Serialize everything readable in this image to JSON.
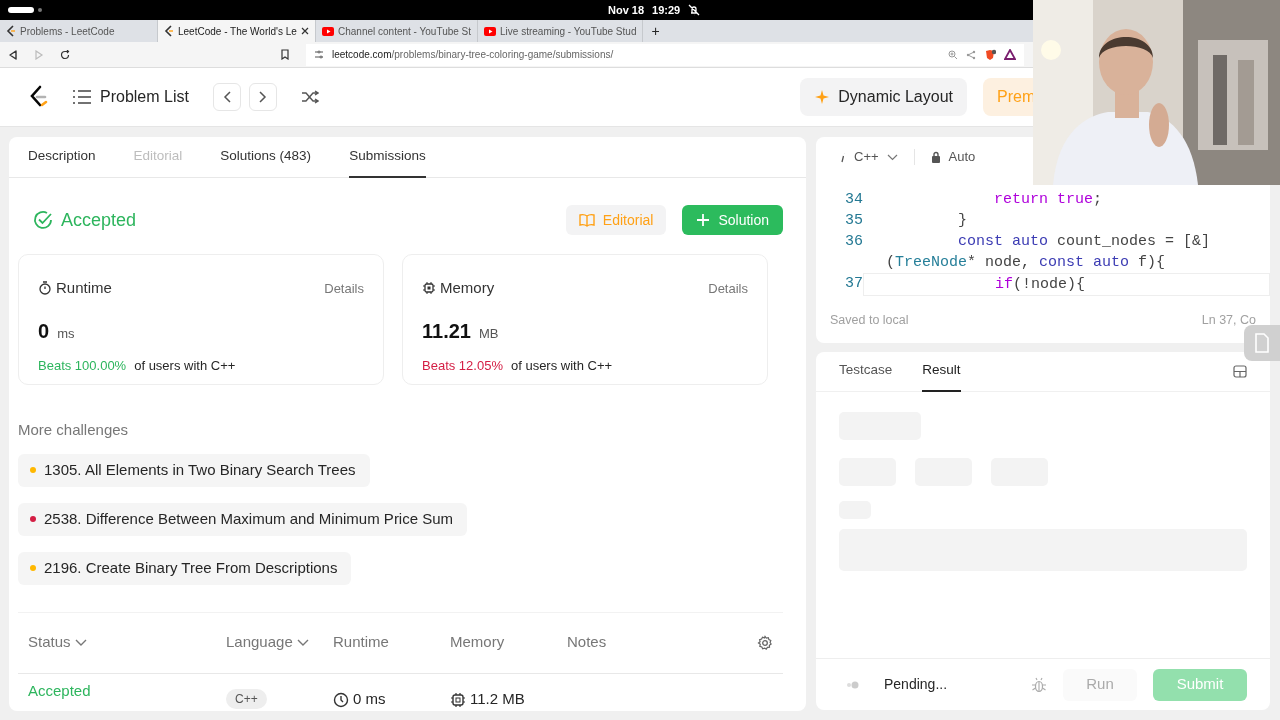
{
  "system_bar": {
    "date": "Nov 18",
    "time": "19:29"
  },
  "browser": {
    "tabs": [
      {
        "title": "Problems - LeetCode",
        "kind": "leetcode",
        "selected": false
      },
      {
        "title": "LeetCode - The World's Le",
        "kind": "leetcode",
        "selected": true
      },
      {
        "title": "Channel content - YouTube St",
        "kind": "youtube",
        "selected": false
      },
      {
        "title": "Live streaming - YouTube Stud",
        "kind": "youtube",
        "selected": false
      }
    ],
    "new_tab": "+",
    "url_host": "leetcode.com",
    "url_path": "/problems/binary-tree-coloring-game/submissions/"
  },
  "nav": {
    "problem_list": "Problem List",
    "dynamic_layout": "Dynamic Layout",
    "premium": "Prem"
  },
  "left_panel": {
    "tabs": [
      {
        "label": "Description",
        "selected": false,
        "disabled": false
      },
      {
        "label": "Editorial",
        "selected": false,
        "disabled": true
      },
      {
        "label": "Solutions (483)",
        "selected": false,
        "disabled": false
      },
      {
        "label": "Submissions",
        "selected": true,
        "disabled": false
      }
    ],
    "result": {
      "status": "Accepted",
      "editorial_button": "Editorial",
      "solution_button": "Solution"
    },
    "stats": [
      {
        "kind": "runtime",
        "title": "Runtime",
        "details": "Details",
        "value": "0",
        "unit": "ms",
        "beats": "Beats 100.00%",
        "color": "#2db55d",
        "suffix": "of users with C++"
      },
      {
        "kind": "memory",
        "title": "Memory",
        "details": "Details",
        "value": "11.21",
        "unit": "MB",
        "beats": "Beats 12.05%",
        "color": "#d41e44",
        "suffix": "of users with C++"
      }
    ],
    "more_challenges": {
      "title": "More challenges",
      "items": [
        {
          "label": "1305. All Elements in Two Binary Search Trees",
          "color": "#ffb800"
        },
        {
          "label": "2538. Difference Between Maximum and Minimum Price Sum",
          "color": "#d41e44"
        },
        {
          "label": "2196. Create Binary Tree From Descriptions",
          "color": "#ffb800"
        }
      ]
    },
    "submissions_table": {
      "columns": [
        {
          "label": "Status",
          "sortable": true
        },
        {
          "label": "Language",
          "sortable": true
        },
        {
          "label": "Runtime",
          "sortable": false
        },
        {
          "label": "Memory",
          "sortable": false
        },
        {
          "label": "Notes",
          "sortable": false
        }
      ],
      "rows": [
        {
          "status": "Accepted",
          "language": "C++",
          "runtime": "0 ms",
          "memory": "11.2 MB"
        }
      ]
    }
  },
  "editor": {
    "language": "C++",
    "mode": "Auto",
    "lines": [
      {
        "number": "34",
        "current": false,
        "rows": [
          [
            {
              "text": "            "
            },
            {
              "text": "return",
              "kind": "keyword"
            },
            {
              "text": " "
            },
            {
              "text": "true",
              "kind": "keyword"
            },
            {
              "text": ";"
            }
          ]
        ]
      },
      {
        "number": "35",
        "current": false,
        "rows": [
          [
            {
              "text": "        }"
            }
          ]
        ]
      },
      {
        "number": "36",
        "current": false,
        "rows": [
          [
            {
              "text": "        "
            },
            {
              "text": "const",
              "kind": "storage"
            },
            {
              "text": " "
            },
            {
              "text": "auto",
              "kind": "storage"
            },
            {
              "text": " count_nodes = [&]"
            }
          ],
          [
            {
              "text": "("
            },
            {
              "text": "TreeNode",
              "kind": "type"
            },
            {
              "text": "* node, "
            },
            {
              "text": "const",
              "kind": "storage"
            },
            {
              "text": " "
            },
            {
              "text": "auto",
              "kind": "storage"
            },
            {
              "text": " f){"
            }
          ]
        ]
      },
      {
        "number": "37",
        "current": true,
        "rows": [
          [
            {
              "text": "            "
            },
            {
              "text": "if",
              "kind": "keyword"
            },
            {
              "text": "(!node){"
            }
          ]
        ]
      }
    ],
    "save_status": "Saved to local",
    "position": "Ln 37, Co"
  },
  "bottom_panel": {
    "tabs": [
      {
        "label": "Testcase",
        "selected": false
      },
      {
        "label": "Result",
        "selected": true
      }
    ],
    "status": "Pending...",
    "run": {
      "label": "Run",
      "disabled": true
    },
    "submit": {
      "label": "Submit",
      "disabled": true
    }
  }
}
